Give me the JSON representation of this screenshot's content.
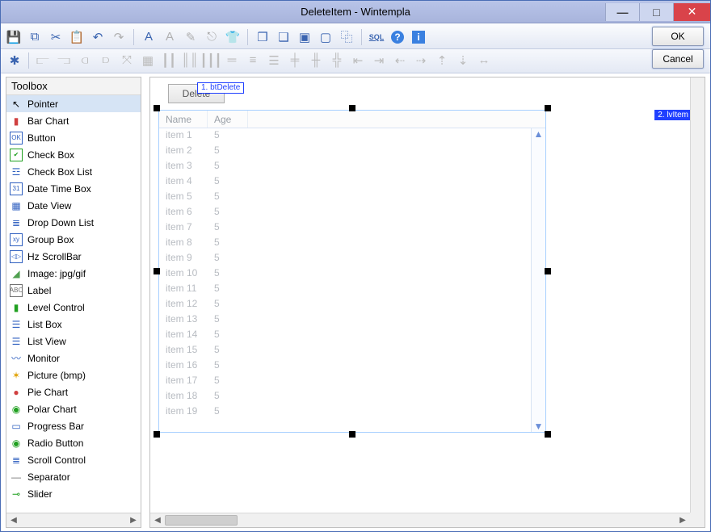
{
  "window": {
    "title": "DeleteItem   -   Wintempla",
    "buttons": {
      "ok": "OK",
      "cancel": "Cancel"
    }
  },
  "toolbox": {
    "title": "Toolbox",
    "items": [
      {
        "label": "Pointer",
        "icon": "↖",
        "color": "#000",
        "selected": true
      },
      {
        "label": "Bar Chart",
        "icon": "▮",
        "color": "#d04040"
      },
      {
        "label": "Button",
        "icon": "OK",
        "color": "#3060c0",
        "boxed": true
      },
      {
        "label": "Check Box",
        "icon": "✔",
        "color": "#20a020",
        "boxed": true
      },
      {
        "label": "Check Box List",
        "icon": "☲",
        "color": "#3060c0"
      },
      {
        "label": "Date Time Box",
        "icon": "31",
        "color": "#3060c0",
        "boxed": true
      },
      {
        "label": "Date View",
        "icon": "▦",
        "color": "#3060c0"
      },
      {
        "label": "Drop Down List",
        "icon": "≣",
        "color": "#3060c0"
      },
      {
        "label": "Group Box",
        "icon": "xy",
        "color": "#3060c0",
        "boxed": true
      },
      {
        "label": "Hz ScrollBar",
        "icon": "◁▷",
        "color": "#3060c0",
        "boxed": true
      },
      {
        "label": "Image: jpg/gif",
        "icon": "◢",
        "color": "#50a050"
      },
      {
        "label": "Label",
        "icon": "ABC",
        "color": "#707070",
        "boxed": true
      },
      {
        "label": "Level Control",
        "icon": "▮",
        "color": "#20a020"
      },
      {
        "label": "List Box",
        "icon": "☰",
        "color": "#3060c0"
      },
      {
        "label": "List View",
        "icon": "☰",
        "color": "#3060c0"
      },
      {
        "label": "Monitor",
        "icon": "〰",
        "color": "#3060c0"
      },
      {
        "label": "Picture (bmp)",
        "icon": "✶",
        "color": "#e0a000"
      },
      {
        "label": "Pie Chart",
        "icon": "●",
        "color": "#d04040"
      },
      {
        "label": "Polar Chart",
        "icon": "◉",
        "color": "#20a020"
      },
      {
        "label": "Progress Bar",
        "icon": "▭",
        "color": "#3060c0"
      },
      {
        "label": "Radio Button",
        "icon": "◉",
        "color": "#20a020"
      },
      {
        "label": "Scroll Control",
        "icon": "≣",
        "color": "#3060c0"
      },
      {
        "label": "Separator",
        "icon": "—",
        "color": "#707070"
      },
      {
        "label": "Slider",
        "icon": "⊸",
        "color": "#20a020"
      }
    ]
  },
  "designer": {
    "btDelete": {
      "text": "Delete",
      "tag": "1. btDelete"
    },
    "lvItem": {
      "tag": "2. lvItem",
      "columns": [
        "Name",
        "Age"
      ],
      "rows": [
        {
          "name": "item 1",
          "age": "5"
        },
        {
          "name": "item 2",
          "age": "5"
        },
        {
          "name": "item 3",
          "age": "5"
        },
        {
          "name": "item 4",
          "age": "5"
        },
        {
          "name": "item 5",
          "age": "5"
        },
        {
          "name": "item 6",
          "age": "5"
        },
        {
          "name": "item 7",
          "age": "5"
        },
        {
          "name": "item 8",
          "age": "5"
        },
        {
          "name": "item 9",
          "age": "5"
        },
        {
          "name": "item 10",
          "age": "5"
        },
        {
          "name": "item 11",
          "age": "5"
        },
        {
          "name": "item 12",
          "age": "5"
        },
        {
          "name": "item 13",
          "age": "5"
        },
        {
          "name": "item 14",
          "age": "5"
        },
        {
          "name": "item 15",
          "age": "5"
        },
        {
          "name": "item 16",
          "age": "5"
        },
        {
          "name": "item 17",
          "age": "5"
        },
        {
          "name": "item 18",
          "age": "5"
        },
        {
          "name": "item 19",
          "age": "5"
        }
      ]
    }
  },
  "toolbar1": {
    "icons": [
      {
        "name": "save-icon",
        "glyph": "💾"
      },
      {
        "name": "copy-icon",
        "glyph": "⧉"
      },
      {
        "name": "cut-icon",
        "glyph": "✂"
      },
      {
        "name": "paste-icon",
        "glyph": "📋",
        "dim": true
      },
      {
        "name": "undo-icon",
        "glyph": "↶"
      },
      {
        "name": "redo-icon",
        "glyph": "↷",
        "dim": true
      }
    ],
    "icons2": [
      {
        "name": "font-bold-icon",
        "glyph": "A"
      },
      {
        "name": "font-outline-icon",
        "glyph": "A",
        "dim": true
      },
      {
        "name": "pencil-icon",
        "glyph": "✎",
        "dim": true
      },
      {
        "name": "dropper-icon",
        "glyph": "⎋",
        "dim": true
      },
      {
        "name": "shirt-icon",
        "glyph": "👕"
      }
    ],
    "icons3": [
      {
        "name": "bring-front-icon",
        "glyph": "❐"
      },
      {
        "name": "send-back-icon",
        "glyph": "❑"
      },
      {
        "name": "group-icon",
        "glyph": "▣"
      },
      {
        "name": "ungroup-icon",
        "glyph": "▢"
      },
      {
        "name": "duplicate-icon",
        "glyph": "⿻"
      }
    ],
    "icons4": [
      {
        "name": "sql-icon",
        "glyph": "SQL"
      },
      {
        "name": "help-icon",
        "glyph": "?"
      },
      {
        "name": "info-icon",
        "glyph": "ℹ"
      }
    ]
  },
  "toolbar2_count": 22
}
